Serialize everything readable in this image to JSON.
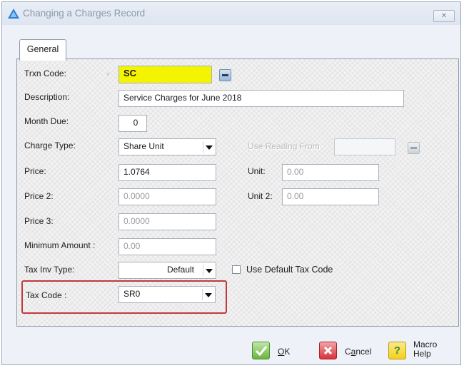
{
  "window": {
    "title": "Changing a Charges Record",
    "close_glyph": "✕"
  },
  "tabs": [
    {
      "label": "General"
    }
  ],
  "form": {
    "trxn_code": {
      "label": "Trxn Code:",
      "value": "SC"
    },
    "description": {
      "label": "Description:",
      "value": "Service Charges for June 2018"
    },
    "month_due": {
      "label": "Month Due:",
      "value": "0"
    },
    "charge_type": {
      "label": "Charge Type:",
      "value": "Share Unit"
    },
    "use_reading_from": {
      "label": "Use Reading From",
      "value": ""
    },
    "price": {
      "label": "Price:",
      "value": "1.0764"
    },
    "unit": {
      "label": "Unit:",
      "value": "0.00"
    },
    "price2": {
      "label": "Price 2:",
      "value": "0.0000"
    },
    "unit2": {
      "label": "Unit 2:",
      "value": "0.00"
    },
    "price3": {
      "label": "Price 3:",
      "value": "0.0000"
    },
    "minimum_amount": {
      "label": "Minimum Amount :",
      "value": "0.00"
    },
    "tax_inv_type": {
      "label": "Tax Inv Type:",
      "value": "Default"
    },
    "use_default_tax_code": {
      "label": "Use Default Tax Code",
      "checked": false
    },
    "tax_code": {
      "label": "Tax Code :",
      "value": "SR0"
    }
  },
  "buttons": {
    "ok": {
      "key": "O",
      "rest": "K"
    },
    "cancel": {
      "pre": "C",
      "key": "a",
      "rest": "ncel"
    },
    "macro_help": {
      "line1": "Macro",
      "line2": "Help"
    }
  },
  "colors": {
    "highlight_box": "#c0393f",
    "trxn_code_bg": "#f4f400",
    "ok_green": "#5cae32",
    "cancel_red": "#d8323a",
    "help_yellow": "#f2d21b"
  }
}
